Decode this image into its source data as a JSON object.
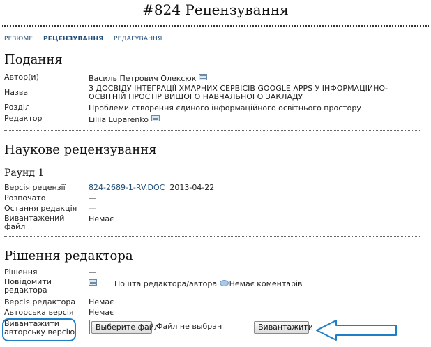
{
  "page": {
    "title": "#824 Рецензування"
  },
  "nav": {
    "items": [
      "РЕЗЮМЕ",
      "РЕЦЕНЗУВАННЯ",
      "РЕДАГУВАННЯ"
    ],
    "active": "РЕЦЕНЗУВАННЯ"
  },
  "submission": {
    "heading": "Подання",
    "author_label": "Автор(и)",
    "author_value": "Василь Петрович Олексюк",
    "title_label": "Назва",
    "title_value": "З ДОСВІДУ ІНТЕГРАЦІЇ ХМАРНИХ СЕРВІСІВ GOOGLE APPS У ІНФОРМАЦІЙНО-ОСВІТНІЙ ПРОСТІР ВИЩОГО НАВЧАЛЬНОГО ЗАКЛАДУ",
    "section_label": "Розділ",
    "section_value": "Проблеми створення єдиного інформаційного освітнього простору",
    "editor_label": "Редактор",
    "editor_value": "Liliia Luparenko"
  },
  "review": {
    "heading": "Наукове рецензування",
    "round": "Раунд 1",
    "version_label": "Версія рецензії",
    "version_file": "824-2689-1-RV.DOC",
    "version_date": "2013-04-22",
    "started_label": "Розпочато",
    "started_value": "—",
    "last_edit_label": "Остання редакція",
    "last_edit_value": "—",
    "uploaded_label": "Вивантажений файл",
    "uploaded_value": "Немає"
  },
  "decision": {
    "heading": "Рішення редактора",
    "decision_label": "Рішення",
    "decision_value": "—",
    "notify_label": "Повідомити редактора",
    "mail_text": "Пошта редактора/автора",
    "comments_text": "Немає коментарів",
    "editor_version_label": "Версія редактора",
    "editor_version_value": "Немає",
    "author_version_label": "Авторська версія",
    "author_version_value": "Немає",
    "upload_label": "Вивантажити авторську версію",
    "choose_file_button": "Выберите файл",
    "no_file_text": "Файл не выбран",
    "upload_button": "Вивантажити"
  },
  "colors": {
    "accent": "#1f4e79",
    "annotation": "#1e7ec8"
  }
}
